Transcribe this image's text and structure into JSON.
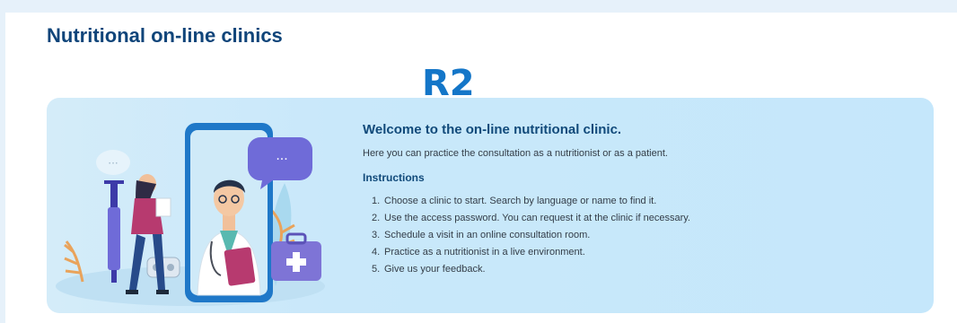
{
  "page": {
    "title": "Nutritional on-line clinics",
    "badge": "R2"
  },
  "welcome": {
    "title": "Welcome to the on-line nutritional clinic.",
    "subtitle": "Here you can practice the consultation as a nutritionist or as a patient.",
    "instructions_heading": "Instructions",
    "steps": [
      {
        "num": "1.",
        "text": "Choose a clinic to start. Search by language or name to find it."
      },
      {
        "num": "2.",
        "text": "Use the access password. You can request it at the clinic if necessary."
      },
      {
        "num": "3.",
        "text": "Schedule a visit in an online consultation room."
      },
      {
        "num": "4.",
        "text": "Practice as a nutritionist in a live environment."
      },
      {
        "num": "5.",
        "text": "Give us your feedback."
      }
    ]
  },
  "illustration": {
    "chat_bubble_left": "···",
    "chat_bubble_right": "···",
    "colors": {
      "phone": "#1f78c8",
      "bubble": "#6f6bd8",
      "kit": "#7e74d6",
      "leaves": "#e9a35b"
    }
  }
}
